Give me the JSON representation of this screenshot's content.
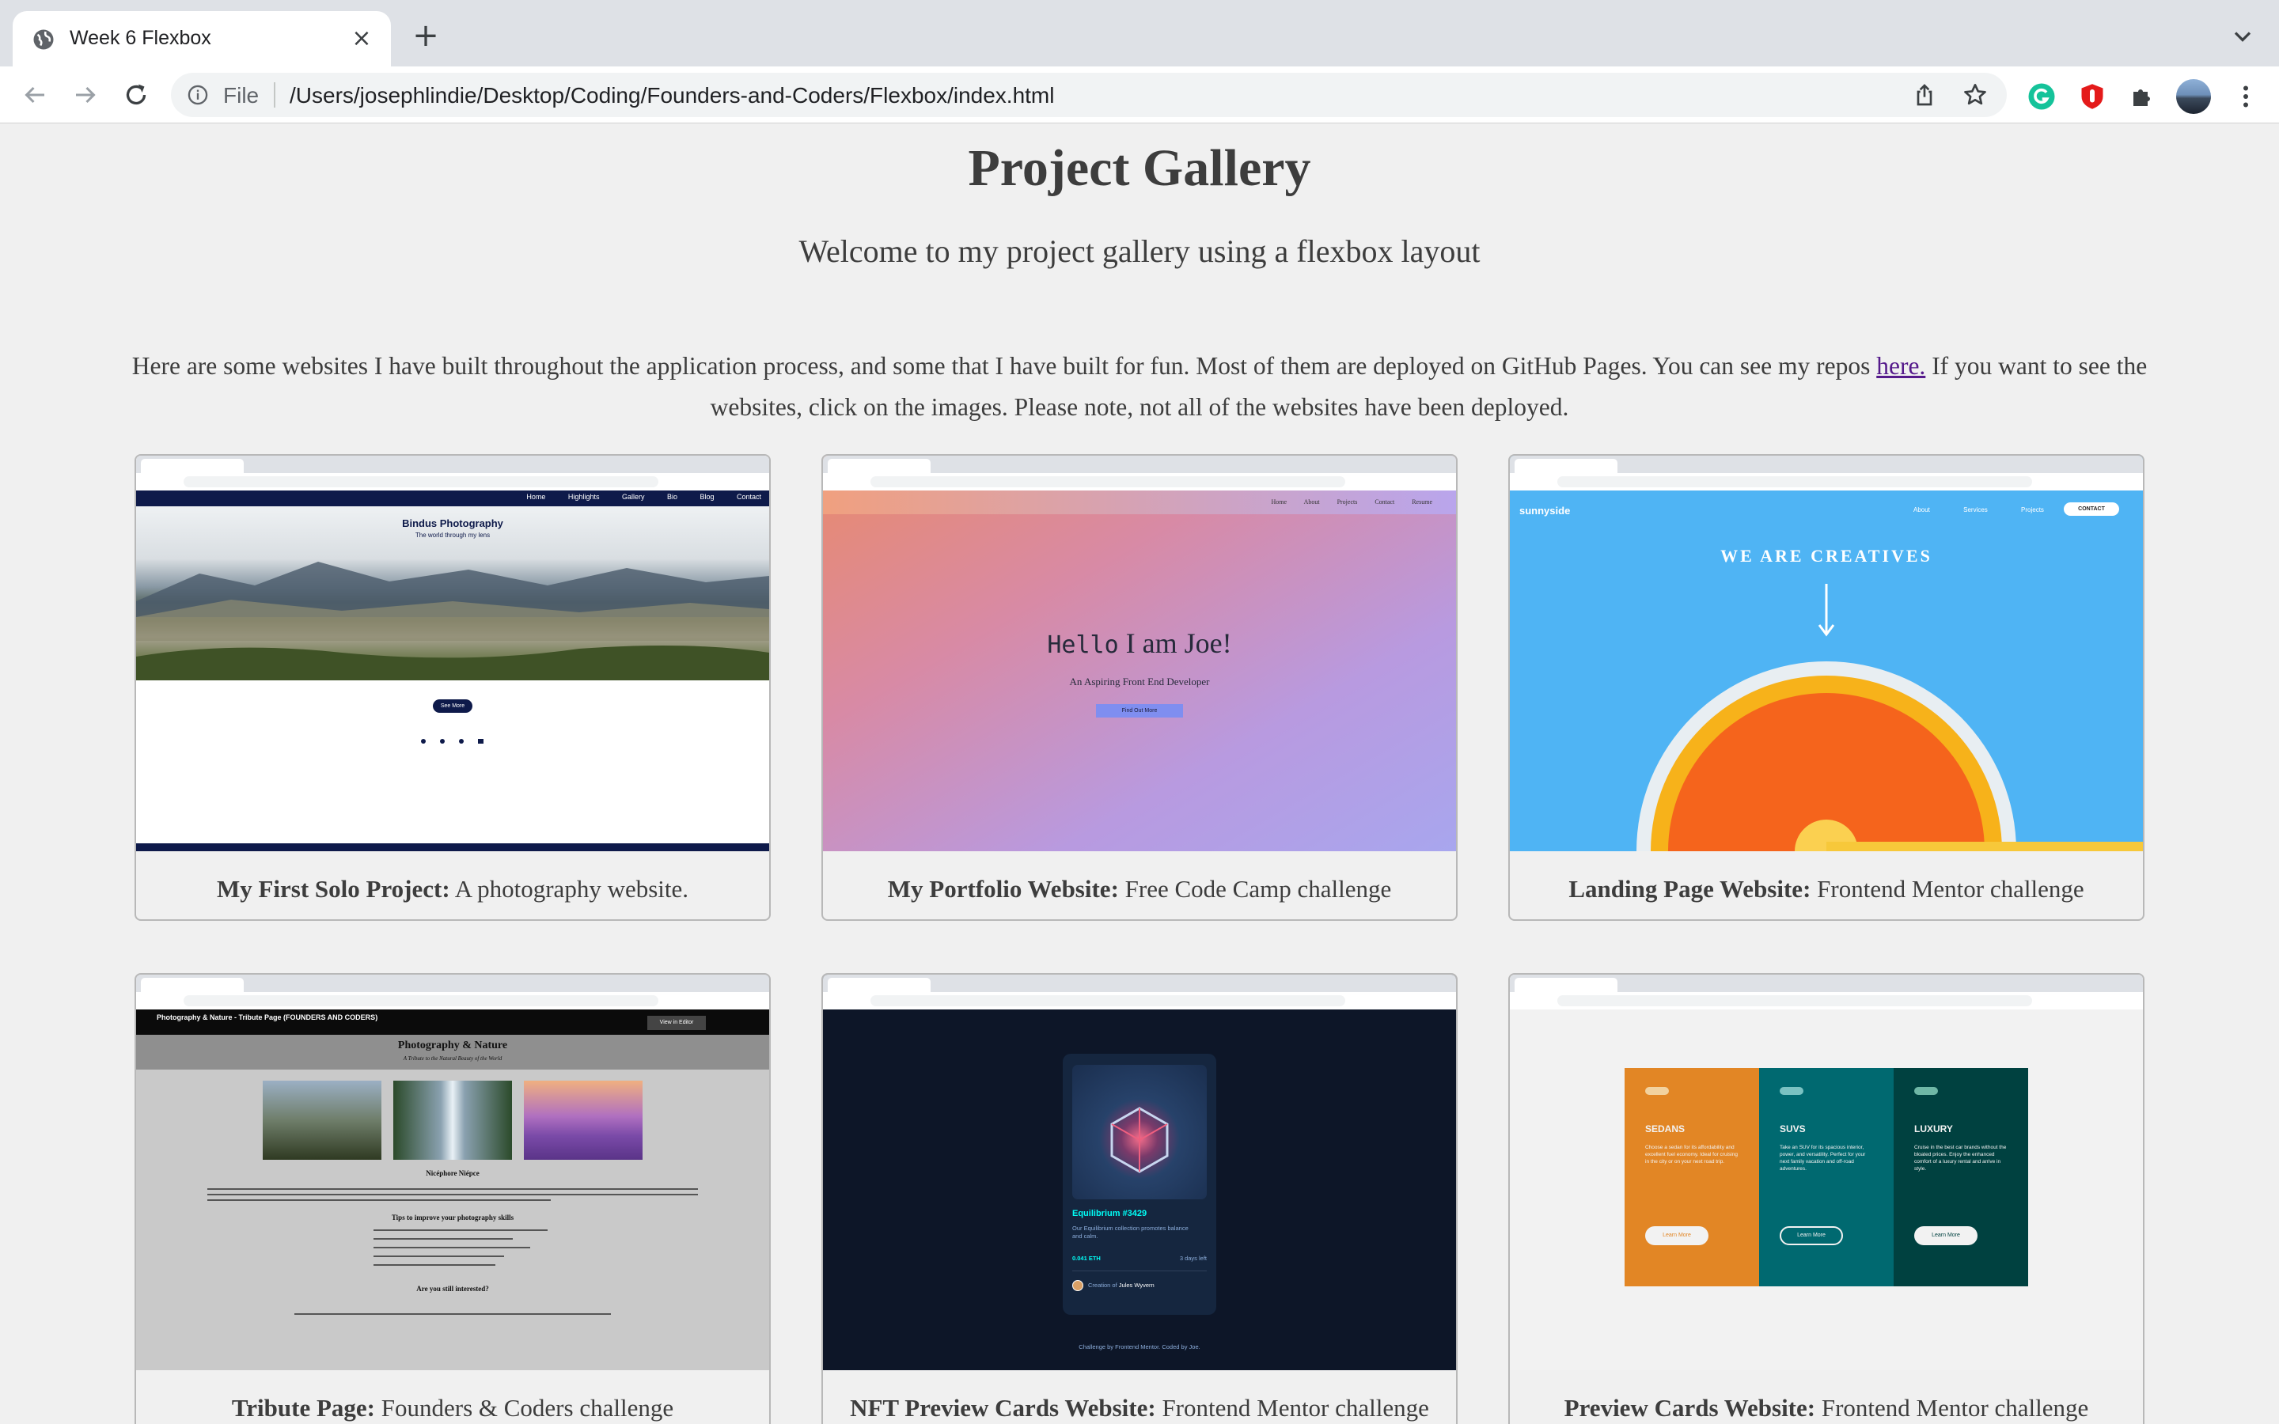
{
  "browser": {
    "tab_title": "Week 6 Flexbox",
    "tab_close": "×",
    "new_tab": "+",
    "url_scheme_label": "File",
    "url": "/Users/josephlindie/Desktop/Coding/Founders-and-Coders/Flexbox/index.html"
  },
  "page": {
    "title": "Project Gallery",
    "subtitle": "Welcome to my project gallery using a flexbox layout",
    "intro_before": "Here are some websites I have built throughout the application process, and some that I have built for fun. Most of them are deployed on GitHub Pages. You can see my repos ",
    "intro_link": "here.",
    "intro_after": " If you want to see the websites, click on the images. Please note, not all of the websites have been deployed."
  },
  "cards": [
    {
      "title": "My First Solo Project:",
      "desc": " A photography website.",
      "shot": {
        "brand": "Bindus Photography",
        "tagline": "The world through my lens",
        "nav": [
          "Home",
          "Highlights",
          "Gallery",
          "Bio",
          "Blog",
          "Contact"
        ],
        "button": "See More"
      }
    },
    {
      "title": "My Portfolio Website:",
      "desc": " Free Code Camp challenge",
      "shot": {
        "hello": "Hello",
        "heading": "I am Joe!",
        "tagline": "An Aspiring Front End Developer",
        "button": "Find Out More",
        "nav": [
          "Home",
          "About",
          "Projects",
          "Contact",
          "Resume"
        ]
      }
    },
    {
      "title": "Landing Page Website:",
      "desc": " Frontend Mentor challenge",
      "shot": {
        "logo": "sunnyside",
        "headline": "WE ARE CREATIVES",
        "nav": [
          "About",
          "Services",
          "Projects",
          "CONTACT"
        ]
      }
    },
    {
      "title": "Tribute Page:",
      "desc": " Founders & Coders challenge",
      "shot": {
        "pen_title": "Photography & Nature - Tribute Page (FOUNDERS AND CODERS)",
        "heading": "Photography & Nature",
        "subheading": "A Tribute to the Natural Beauty of the World",
        "person": "Nicéphore Niépce",
        "tips": "Tips to improve your photography skills",
        "question": "Are you still interested?",
        "editor_btn": "View in Editor"
      }
    },
    {
      "title": "NFT Preview Cards Website:",
      "desc": " Frontend Mentor challenge",
      "shot": {
        "nft_title": "Equilibrium #3429",
        "nft_desc": "Our Equilibrium collection promotes balance and calm.",
        "price": "0.041 ETH",
        "days": "3 days left",
        "creator_prefix": "Creation of ",
        "creator": "Jules Wyvern",
        "footer": "Challenge by Frontend Mentor. Coded by Joe."
      }
    },
    {
      "title": "Preview Cards Website:",
      "desc": " Frontend Mentor challenge",
      "shot": {
        "columns": [
          {
            "name": "SEDANS",
            "text": "Choose a sedan for its affordability and excellent fuel economy. Ideal for cruising in the city or on your next road trip.",
            "button": "Learn More",
            "color": "#e28625"
          },
          {
            "name": "SUVS",
            "text": "Take an SUV for its spacious interior, power, and versatility. Perfect for your next family vacation and off-road adventures.",
            "button": "Learn More",
            "color": "#006970"
          },
          {
            "name": "LUXURY",
            "text": "Cruise in the best car brands without the bloated prices. Enjoy the enhanced comfort of a luxury rental and arrive in style.",
            "button": "Learn More",
            "color": "#004140"
          }
        ]
      }
    }
  ],
  "colors": {
    "page_bg": "#f0f0f0",
    "link": "#551a8b",
    "card_border": "#b8b8b8"
  }
}
